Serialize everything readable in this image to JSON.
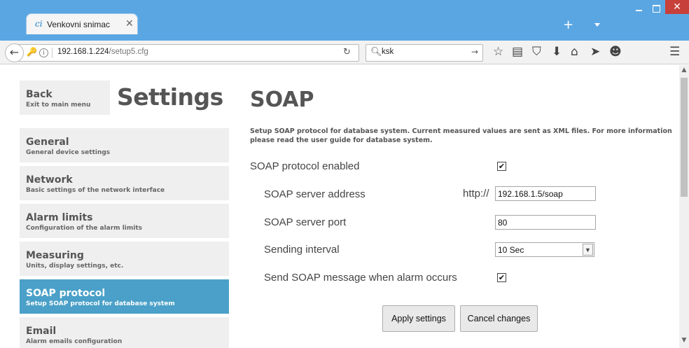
{
  "browser": {
    "tab_title": "Venkovni snimac",
    "tab_icon": "ci",
    "url_host": "192.168.1.224",
    "url_path": "/setup5.cfg",
    "search_value": "ksk"
  },
  "sidebar": {
    "back": {
      "title": "Back",
      "subtitle": "Exit to main menu"
    },
    "heading": "Settings",
    "items": [
      {
        "title": "General",
        "subtitle": "General device settings",
        "active": false
      },
      {
        "title": "Network",
        "subtitle": "Basic settings of the network interface",
        "active": false
      },
      {
        "title": "Alarm limits",
        "subtitle": "Configuration of the alarm limits",
        "active": false
      },
      {
        "title": "Measuring",
        "subtitle": "Units, display settings, etc.",
        "active": false
      },
      {
        "title": "SOAP protocol",
        "subtitle": "Setup SOAP protocol for database system",
        "active": true
      },
      {
        "title": "Email",
        "subtitle": "Alarm emails configuration",
        "active": false
      }
    ]
  },
  "main": {
    "title": "SOAP",
    "description": "Setup SOAP protocol for database system. Current measured values are sent as XML files. For more information please read the user guide for database system.",
    "soap_enabled_label": "SOAP protocol enabled",
    "soap_enabled": true,
    "server_address_label": "SOAP server address",
    "server_address_prefix": "http://",
    "server_address_value": "192.168.1.5/soap",
    "server_port_label": "SOAP server port",
    "server_port_value": "80",
    "interval_label": "Sending interval",
    "interval_value": "10 Sec",
    "alarm_label": "Send SOAP message when alarm occurs",
    "alarm_enabled": true,
    "apply_label": "Apply settings",
    "cancel_label": "Cancel changes"
  },
  "colors": {
    "titlebar": "#5aa6e3",
    "active_menu": "#4aa0c8",
    "menu_bg": "#efefef",
    "close_button": "#c7403a"
  }
}
